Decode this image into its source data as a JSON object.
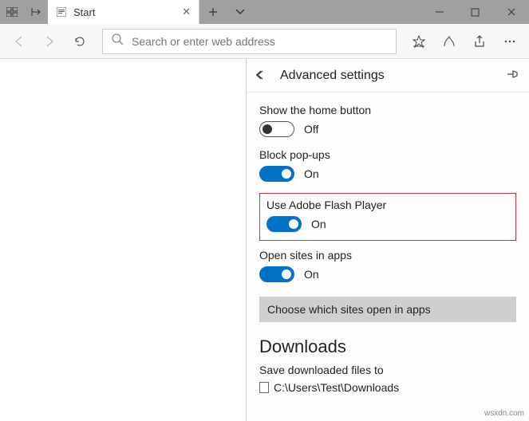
{
  "tab": {
    "title": "Start"
  },
  "omnibox": {
    "placeholder": "Search or enter web address"
  },
  "panel": {
    "title": "Advanced settings",
    "home_button": {
      "label": "Show the home button",
      "state": "Off",
      "on": false
    },
    "block_popups": {
      "label": "Block pop-ups",
      "state": "On",
      "on": true
    },
    "flash": {
      "label": "Use Adobe Flash Player",
      "state": "On",
      "on": true
    },
    "open_in_apps": {
      "label": "Open sites in apps",
      "state": "On",
      "on": true
    },
    "choose_sites_btn": "Choose which sites open in apps",
    "downloads": {
      "heading": "Downloads",
      "save_label": "Save downloaded files to",
      "path": "C:\\Users\\Test\\Downloads"
    }
  },
  "watermark": "wsxdn.com"
}
